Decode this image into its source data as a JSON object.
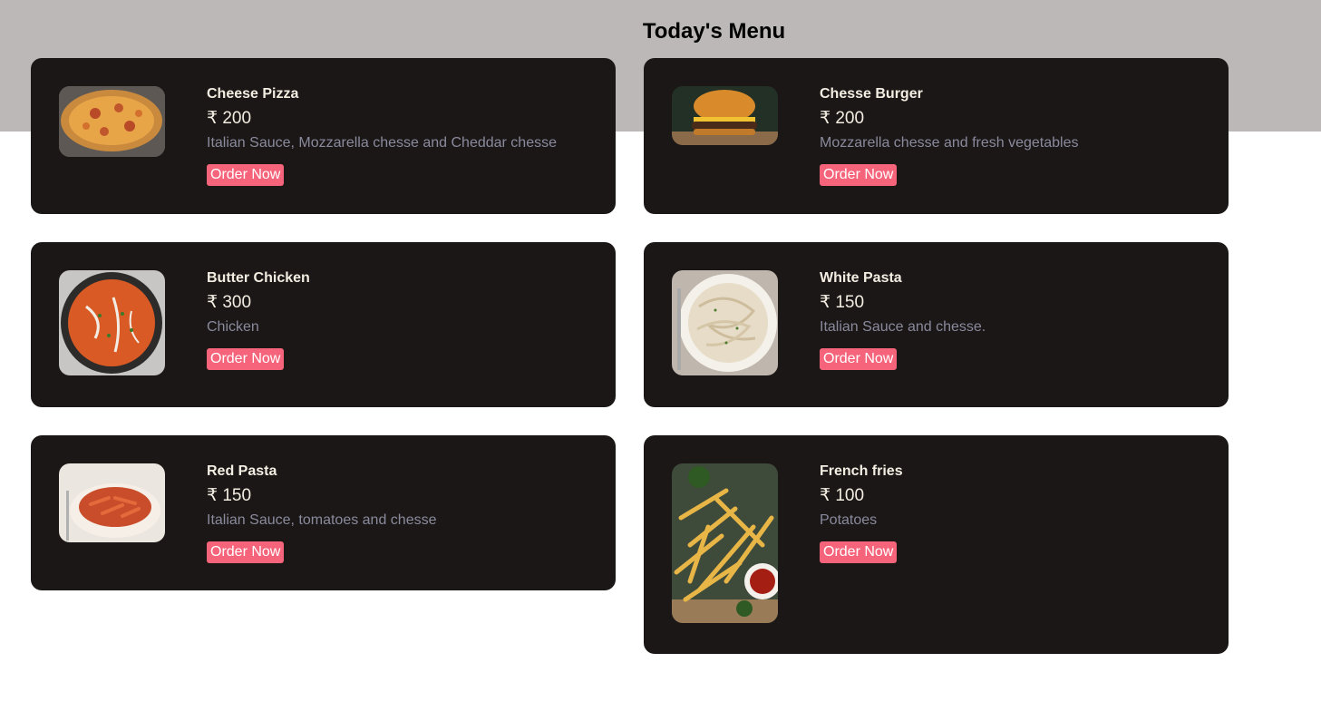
{
  "page": {
    "title": "Today's Menu"
  },
  "menu": {
    "items": [
      {
        "name": "Cheese Pizza",
        "price": "₹ 200",
        "description": "Italian Sauce, Mozzarella chesse and Cheddar chesse",
        "button_label": "Order Now",
        "image_icon": "pizza-image"
      },
      {
        "name": "Chesse Burger",
        "price": "₹ 200",
        "description": "Mozzarella chesse and fresh vegetables",
        "button_label": "Order Now",
        "image_icon": "burger-image"
      },
      {
        "name": "Butter Chicken",
        "price": "₹ 300",
        "description": "Chicken",
        "button_label": "Order Now",
        "image_icon": "butter-chicken-image"
      },
      {
        "name": "White Pasta",
        "price": "₹ 150",
        "description": "Italian Sauce and chesse.",
        "button_label": "Order Now",
        "image_icon": "white-pasta-image"
      },
      {
        "name": "Red Pasta",
        "price": "₹ 150",
        "description": "Italian Sauce, tomatoes and chesse",
        "button_label": "Order Now",
        "image_icon": "red-pasta-image"
      },
      {
        "name": "French fries",
        "price": "₹ 100",
        "description": "Potatoes",
        "button_label": "Order Now",
        "image_icon": "french-fries-image"
      }
    ]
  },
  "colors": {
    "header_band": "#bdb8b8",
    "card_background": "#1b1716",
    "title_text": "#f3ede2",
    "description_text": "#8a8a9d",
    "button_background": "#f5647a"
  }
}
